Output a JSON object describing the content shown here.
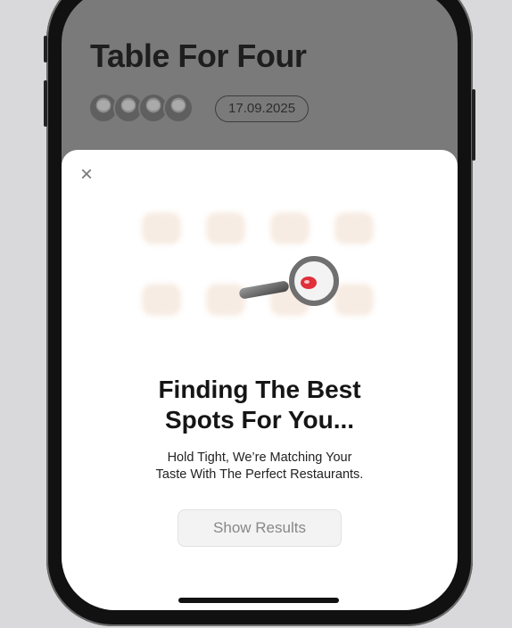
{
  "header": {
    "title": "Table For Four",
    "date": "17.09.2025",
    "avatars": [
      "avatar-1",
      "avatar-2",
      "avatar-3",
      "avatar-4"
    ]
  },
  "modal": {
    "close_icon": "close-icon",
    "illustration": "magnifier-over-food-icons",
    "heading_line1": "Finding The Best",
    "heading_line2": "Spots For You...",
    "subtext_line1": "Hold Tight, We’re Matching Your",
    "subtext_line2": "Taste With The Perfect Restaurants.",
    "button_label": "Show Results"
  },
  "colors": {
    "background_dim": "#7a7a7a",
    "sheet": "#ffffff",
    "button_disabled": "#f3f3f3",
    "accent_red": "#e0303b"
  }
}
